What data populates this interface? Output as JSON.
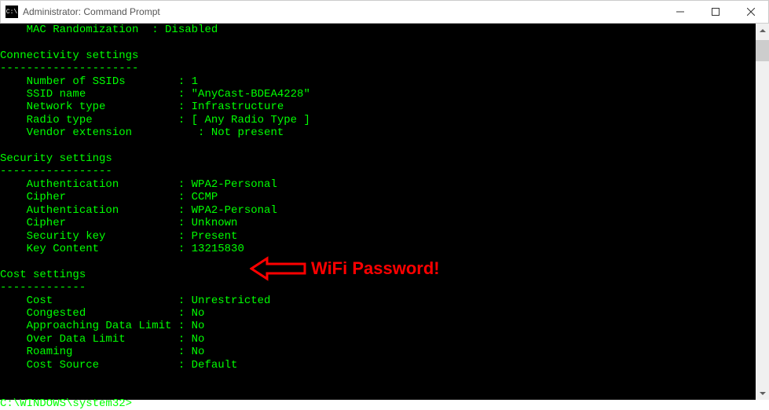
{
  "window": {
    "title": "Administrator: Command Prompt",
    "icon_label": "C:\\"
  },
  "annotation": {
    "text": "WiFi Password!"
  },
  "terminal": {
    "lines": {
      "mac_rand": "    MAC Randomization  : Disabled",
      "blank1": "",
      "conn_hdr": "Connectivity settings",
      "conn_dash": "---------------------",
      "num_ssids": "    Number of SSIDs        : 1",
      "ssid_name": "    SSID name              : \"AnyCast-BDEA4228\"",
      "net_type": "    Network type           : Infrastructure",
      "radio_type": "    Radio type             : [ Any Radio Type ]",
      "vendor_ext": "    Vendor extension          : Not present",
      "blank2": "",
      "sec_hdr": "Security settings",
      "sec_dash": "-----------------",
      "auth1": "    Authentication         : WPA2-Personal",
      "cipher1": "    Cipher                 : CCMP",
      "auth2": "    Authentication         : WPA2-Personal",
      "cipher2": "    Cipher                 : Unknown",
      "sec_key": "    Security key           : Present",
      "key_content": "    Key Content            : 13215830",
      "blank3": "",
      "cost_hdr": "Cost settings",
      "cost_dash": "-------------",
      "cost": "    Cost                   : Unrestricted",
      "congested": "    Congested              : No",
      "appr_limit": "    Approaching Data Limit : No",
      "over_limit": "    Over Data Limit        : No",
      "roaming": "    Roaming                : No",
      "cost_source": "    Cost Source            : Default",
      "blank4": "",
      "blank5": "",
      "prompt": "C:\\WINDOWS\\system32>"
    }
  }
}
